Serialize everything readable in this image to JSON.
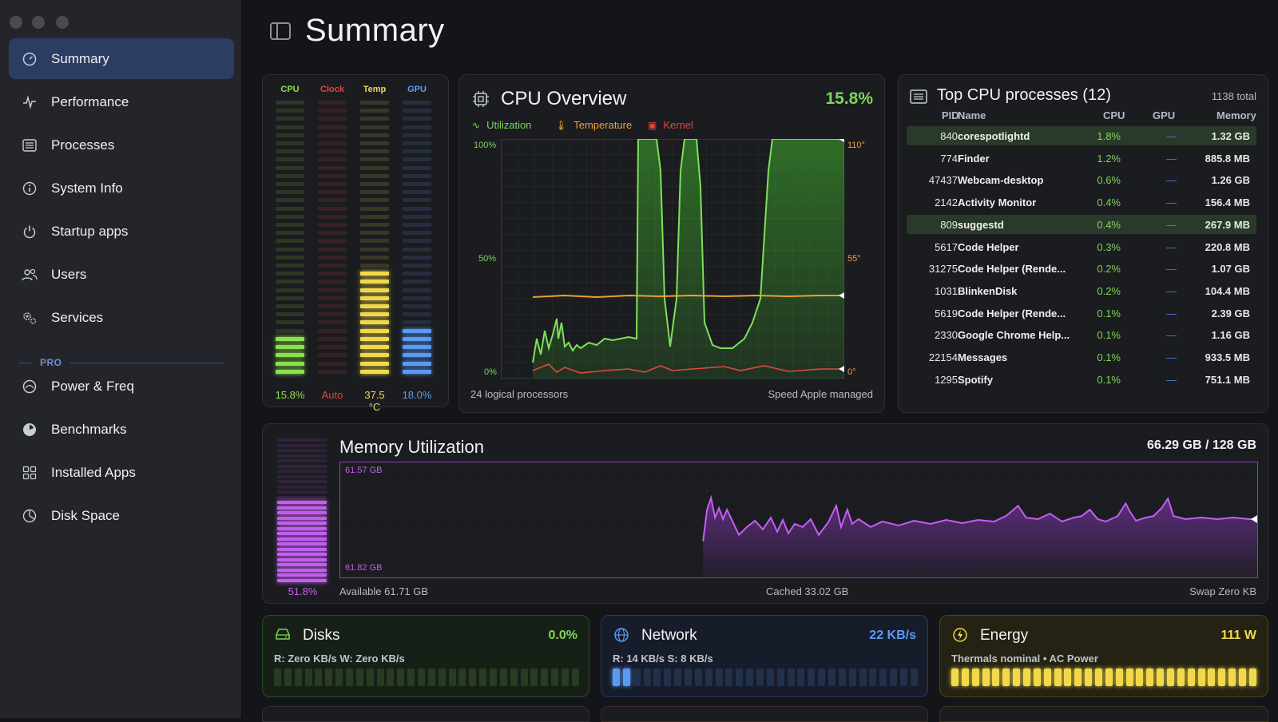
{
  "sidebar": {
    "items": [
      {
        "label": "Summary",
        "icon": "gauge-icon"
      },
      {
        "label": "Performance",
        "icon": "pulse-icon"
      },
      {
        "label": "Processes",
        "icon": "list-icon"
      },
      {
        "label": "System Info",
        "icon": "info-icon"
      },
      {
        "label": "Startup apps",
        "icon": "power-icon"
      },
      {
        "label": "Users",
        "icon": "users-icon"
      },
      {
        "label": "Services",
        "icon": "gears-icon"
      }
    ],
    "pro_label": "PRO",
    "pro_items": [
      {
        "label": "Power & Freq",
        "icon": "gauge-icon"
      },
      {
        "label": "Benchmarks",
        "icon": "timer-icon"
      },
      {
        "label": "Installed Apps",
        "icon": "grid-icon"
      },
      {
        "label": "Disk Space",
        "icon": "pie-icon"
      }
    ]
  },
  "header": {
    "title": "Summary"
  },
  "gauges": [
    {
      "label": "CPU",
      "value": "15.8%",
      "level": 0.158,
      "color": "#8be04c"
    },
    {
      "label": "Clock",
      "value": "Auto",
      "level": 0.0,
      "color": "#e0483c"
    },
    {
      "label": "Temp",
      "value": "37.5 °C",
      "level": 0.375,
      "color": "#f2d94a"
    },
    {
      "label": "GPU",
      "value": "18.0%",
      "level": 0.18,
      "color": "#5a9af5"
    }
  ],
  "cpu_overview": {
    "title": "CPU Overview",
    "value": "15.8%",
    "legend": [
      {
        "label": "Utilization",
        "color": "#7cd65a"
      },
      {
        "label": "Temperature",
        "color": "#f0a030"
      },
      {
        "label": "Kernel",
        "color": "#e0483c"
      }
    ],
    "left_axis": [
      "100%",
      "50%",
      "0%"
    ],
    "right_axis": [
      "110°",
      "55°",
      "0°"
    ],
    "footer_left": "24 logical processors",
    "footer_right": "Speed Apple managed"
  },
  "top_processes": {
    "title": "Top CPU processes (12)",
    "total": "1138 total",
    "columns": [
      "PID",
      "Name",
      "CPU",
      "GPU",
      "Memory"
    ],
    "rows": [
      {
        "pid": "840",
        "name": "corespotlightd",
        "cpu": "1.8%",
        "gpu": "—",
        "mem": "1.32 GB",
        "hl": true
      },
      {
        "pid": "774",
        "name": "Finder",
        "cpu": "1.2%",
        "gpu": "—",
        "mem": "885.8 MB",
        "hl": false
      },
      {
        "pid": "47437",
        "name": "Webcam-desktop",
        "cpu": "0.6%",
        "gpu": "—",
        "mem": "1.26 GB",
        "hl": false
      },
      {
        "pid": "2142",
        "name": "Activity Monitor",
        "cpu": "0.4%",
        "gpu": "—",
        "mem": "156.4 MB",
        "hl": false
      },
      {
        "pid": "809",
        "name": "suggestd",
        "cpu": "0.4%",
        "gpu": "—",
        "mem": "267.9 MB",
        "hl": true
      },
      {
        "pid": "5617",
        "name": "Code Helper",
        "cpu": "0.3%",
        "gpu": "—",
        "mem": "220.8 MB",
        "hl": false
      },
      {
        "pid": "31275",
        "name": "Code Helper (Rende...",
        "cpu": "0.2%",
        "gpu": "—",
        "mem": "1.07 GB",
        "hl": false
      },
      {
        "pid": "1031",
        "name": "BlinkenDisk",
        "cpu": "0.2%",
        "gpu": "—",
        "mem": "104.4 MB",
        "hl": false
      },
      {
        "pid": "5619",
        "name": "Code Helper (Rende...",
        "cpu": "0.1%",
        "gpu": "—",
        "mem": "2.39 GB",
        "hl": false
      },
      {
        "pid": "2330",
        "name": "Google Chrome Help...",
        "cpu": "0.1%",
        "gpu": "—",
        "mem": "1.16 GB",
        "hl": false
      },
      {
        "pid": "22154",
        "name": "Messages",
        "cpu": "0.1%",
        "gpu": "—",
        "mem": "933.5 MB",
        "hl": false
      },
      {
        "pid": "1295",
        "name": "Spotify",
        "cpu": "0.1%",
        "gpu": "—",
        "mem": "751.1 MB",
        "hl": false
      }
    ]
  },
  "memory": {
    "title": "Memory Utilization",
    "total": "66.29 GB / 128 GB",
    "percent": "51.8%",
    "level": 0.518,
    "chart_top_label": "61.57 GB",
    "chart_bottom_label": "61.82 GB",
    "available": "Available 61.71 GB",
    "cached": "Cached 33.02 GB",
    "swap": "Swap Zero KB"
  },
  "cards": [
    {
      "title": "Disks",
      "value": "0.0%",
      "sub": "R: Zero KB/s  W: Zero KB/s",
      "color": "#7cd65a",
      "icon": "disk-icon",
      "level": 0.0
    },
    {
      "title": "Network",
      "value": "22 KB/s",
      "sub": "R: 14 KB/s  S: 8 KB/s",
      "color": "#5a9af5",
      "icon": "globe-icon",
      "level": 0.06
    },
    {
      "title": "Energy",
      "value": "111 W",
      "sub": "Thermals nominal • AC Power",
      "color": "#f2d94a",
      "icon": "bolt-icon",
      "level": 1.0
    }
  ]
}
